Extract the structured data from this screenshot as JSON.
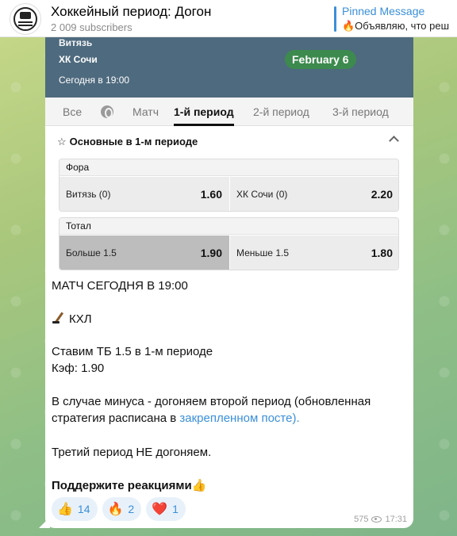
{
  "header": {
    "title": "Хоккейный период: Догон",
    "subscribers": "2 009 subscribers",
    "pinned_label": "Pinned Message",
    "pinned_text": "🔥Объявляю, что реш"
  },
  "match": {
    "team1": "Витязь",
    "team2": "ХК Сочи",
    "time": "Сегодня в 19:00",
    "date": "February 6"
  },
  "tabs": [
    {
      "label": "Все"
    },
    {
      "label": "Матч"
    },
    {
      "label": "1-й период"
    },
    {
      "label": "2-й период"
    },
    {
      "label": "3-й период"
    }
  ],
  "section": {
    "star": "☆",
    "title": "Основные в 1-м периоде"
  },
  "markets": [
    {
      "title": "Фора",
      "left": {
        "name": "Витязь (0)",
        "odd": "1.60"
      },
      "right": {
        "name": "ХК Сочи (0)",
        "odd": "2.20"
      }
    },
    {
      "title": "Тотал",
      "left": {
        "name": "Больше 1.5",
        "odd": "1.90"
      },
      "right": {
        "name": "Меньше 1.5",
        "odd": "1.80"
      }
    }
  ],
  "message": {
    "line1": "МАТЧ СЕГОДНЯ В 19:00",
    "league": "КХЛ",
    "bet_line": "Ставим ТБ 1.5 в 1-м периоде",
    "coef_line": "Кэф: 1.90",
    "minus_line1": "В случае минуса - догоняем второй период (обновленная",
    "minus_line2_start": "стратегия расписана в ",
    "minus_link": "закрепленном посте).",
    "third_line": "Третий период НЕ догоняем.",
    "support_line": "Поддержите реакциями👍"
  },
  "reactions": [
    {
      "emoji": "👍",
      "count": "14"
    },
    {
      "emoji": "🔥",
      "count": "2"
    },
    {
      "emoji": "❤️",
      "count": "1"
    }
  ],
  "meta": {
    "views": "575",
    "time": "17:31"
  },
  "colors": {
    "accent": "#3a8fd9",
    "scorebox": "#4e6a7e",
    "date_pill": "#3d8a4e"
  }
}
